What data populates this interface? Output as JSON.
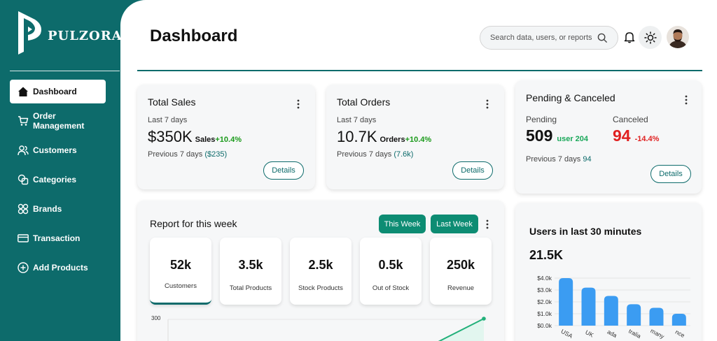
{
  "brand": {
    "name": "PULZORA"
  },
  "sidebar": {
    "items": [
      {
        "label": "Dashboard",
        "icon": "home-icon",
        "active": true
      },
      {
        "label": "Order Management",
        "icon": "cart-icon"
      },
      {
        "label": "Customers",
        "icon": "users-icon"
      },
      {
        "label": "Categories",
        "icon": "categories-icon"
      },
      {
        "label": "Brands",
        "icon": "brands-icon"
      },
      {
        "label": "Transaction",
        "icon": "card-icon"
      },
      {
        "label": "Add Products",
        "icon": "plus-circle-icon"
      }
    ]
  },
  "header": {
    "title": "Dashboard",
    "search_placeholder": "Search data, users, or reports"
  },
  "cards": {
    "total_sales": {
      "title": "Total Sales",
      "period": "Last 7 days",
      "value": "$350K",
      "value_label": "Sales",
      "change": "+10.4%",
      "previous_label": "Previous 7 days",
      "previous_value": "($235)",
      "button": "Details"
    },
    "total_orders": {
      "title": "Total Orders",
      "period": "Last 7 days",
      "value": "10.7K",
      "value_label": "Orders",
      "change": "+10.4%",
      "previous_label": "Previous 7 days",
      "previous_value": "(7.6k)",
      "button": "Details"
    },
    "pending_canceled": {
      "title": "Pending & Canceled",
      "pending_label": "Pending",
      "pending_value": "509",
      "pending_sub": "user 204",
      "canceled_label": "Canceled",
      "canceled_value": "94",
      "canceled_change": "-14.4%",
      "previous_label": "Previous 7 days",
      "previous_value": "94",
      "button": "Details"
    }
  },
  "report": {
    "title": "Report for this week",
    "this_week": "This Week",
    "last_week": "Last Week",
    "stats": [
      {
        "value": "52k",
        "label": "Customers"
      },
      {
        "value": "3.5k",
        "label": "Total Products"
      },
      {
        "value": "2.5k",
        "label": "Stock Products"
      },
      {
        "value": "0.5k",
        "label": "Out of Stock"
      },
      {
        "value": "250k",
        "label": "Revenue"
      }
    ],
    "chart_y_label": "300"
  },
  "users_card": {
    "title": "Users in last 30 minutes",
    "value": "21.5K"
  },
  "chart_data": {
    "type": "bar",
    "categories": [
      "USA",
      "UK",
      "Canada",
      "Australia",
      "Germany",
      "France"
    ],
    "visible_category_labels": [
      "USA",
      "UK",
      "ada",
      "tralia",
      "many",
      "nce"
    ],
    "values": [
      4.0,
      3.2,
      2.5,
      1.8,
      1.5,
      1.0
    ],
    "yticks": [
      "$4.0k",
      "$3.0k",
      "$2.0k",
      "$1.0k",
      "$0.0k"
    ],
    "ylim": [
      0,
      4.0
    ],
    "bar_color": "#3b9cf2"
  },
  "colors": {
    "brand": "#0d6b6b",
    "button": "#0d8c73",
    "positive": "#1a9a1a",
    "negative": "#e02020",
    "bar": "#3b9cf2"
  }
}
